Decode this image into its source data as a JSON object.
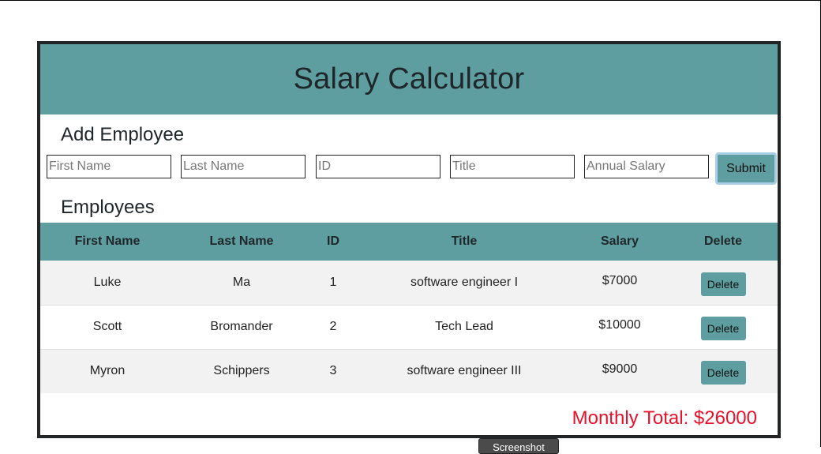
{
  "header": {
    "title": "Salary Calculator"
  },
  "form": {
    "heading": "Add Employee",
    "first_name_placeholder": "First Name",
    "last_name_placeholder": "Last Name",
    "id_placeholder": "ID",
    "title_placeholder": "Title",
    "salary_placeholder": "Annual Salary",
    "submit_label": "Submit"
  },
  "employees": {
    "heading": "Employees",
    "columns": [
      "First Name",
      "Last Name",
      "ID",
      "Title",
      "Salary",
      "Delete"
    ],
    "rows": [
      {
        "first": "Luke",
        "last": "Ma",
        "id": "1",
        "title": "software engineer I",
        "salary": "$7000",
        "delete_label": "Delete"
      },
      {
        "first": "Scott",
        "last": "Bromander",
        "id": "2",
        "title": "Tech Lead",
        "salary": "$10000",
        "delete_label": "Delete"
      },
      {
        "first": "Myron",
        "last": "Schippers",
        "id": "3",
        "title": "software engineer III",
        "salary": "$9000",
        "delete_label": "Delete"
      }
    ]
  },
  "total": {
    "label": "Monthly Total: $26000"
  },
  "screenshot_button": {
    "label": "Screenshot"
  },
  "colors": {
    "accent": "#5f9ea0",
    "total": "#e8102a",
    "border": "#232425"
  }
}
